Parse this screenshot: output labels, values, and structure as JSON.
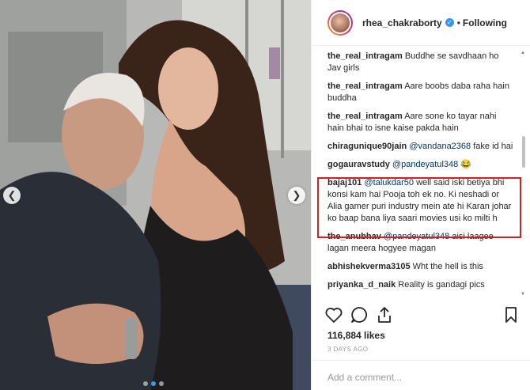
{
  "post": {
    "username": "rhea_chakraborty",
    "follow_label": "Following",
    "separator": "•",
    "likes": "116,884 likes",
    "timestamp": "3 DAYS AGO",
    "add_comment_placeholder": "Add a comment..."
  },
  "comments": [
    {
      "user": "the_real_intragam",
      "mention": "",
      "text": "Buddhe se savdhaan ho Jav girls"
    },
    {
      "user": "the_real_intragam",
      "mention": "",
      "text": "Aare boobs daba raha hain buddha"
    },
    {
      "user": "the_real_intragam",
      "mention": "",
      "text": "Aare sone ko tayar nahi hain bhai to isne kaise pakda hain"
    },
    {
      "user": "chiragunique90jain",
      "mention": "@vandana2368",
      "text": "fake id hai"
    },
    {
      "user": "gogauravstudy",
      "mention": "@pandeyatul348",
      "text": "😂"
    },
    {
      "user": "bajaj101",
      "mention": "@talukdar50",
      "text": "well said iski betiya bhi konsi kam hai Pooja toh ek no. Ki neshadi or Alia gamer puri industry mein ate hi Karan johar ko baap bana liya saari movies usi ko milti h"
    },
    {
      "user": "the_anubhav",
      "mention": "@pandeyatul348",
      "text": "aisi laagee lagan meera hogyee magan"
    },
    {
      "user": "abhishekverma3105",
      "mention": "",
      "text": "Wht the hell is this"
    },
    {
      "user": "priyanka_d_naik",
      "mention": "",
      "text": "Reality is gandagi pics"
    }
  ],
  "icons": {
    "like": "heart-icon",
    "comment": "comment-bubble-icon",
    "share": "share-icon",
    "save": "bookmark-icon",
    "prev": "chevron-left-icon",
    "next": "chevron-right-icon"
  },
  "colors": {
    "highlight": "#e01b1b",
    "link": "#003569",
    "verified": "#3897f0"
  }
}
